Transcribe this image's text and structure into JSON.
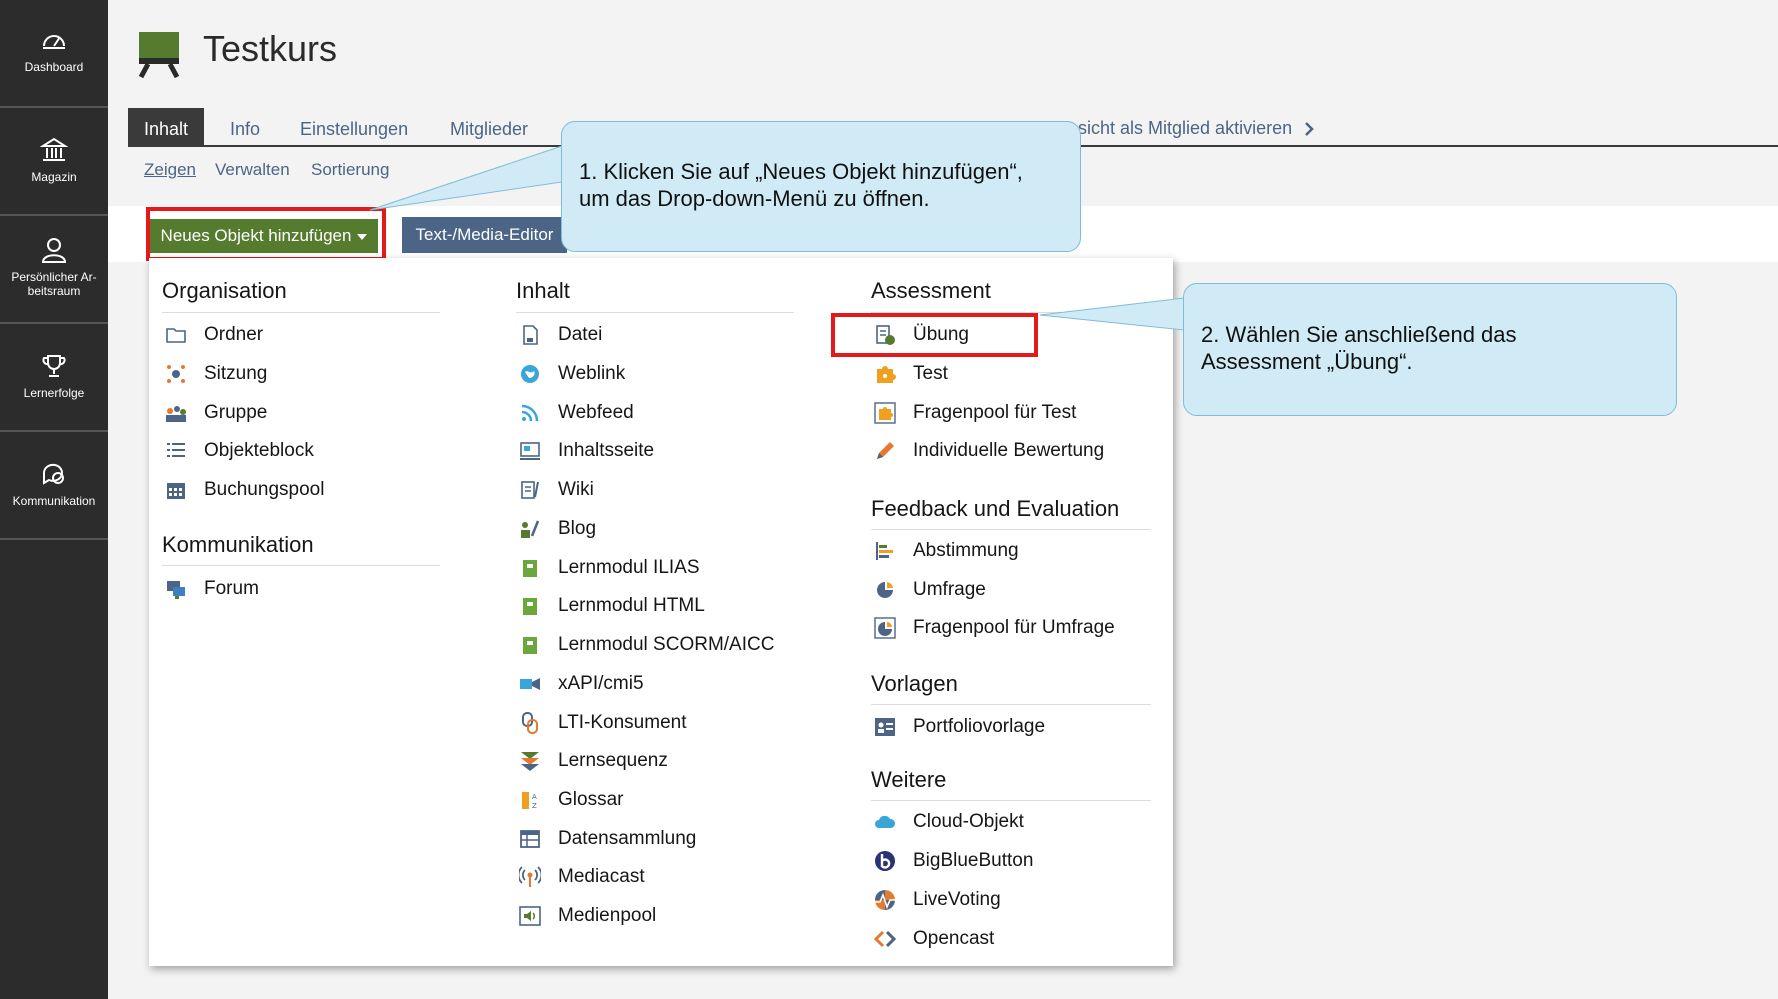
{
  "sidebar": {
    "items": [
      {
        "label": "Dashboard",
        "icon": "dashboard-icon"
      },
      {
        "label": "Magazin",
        "icon": "bank-icon"
      },
      {
        "label": "Persönlicher Ar-beitsraum",
        "icon": "user-icon"
      },
      {
        "label": "Lernerfolge",
        "icon": "trophy-icon"
      },
      {
        "label": "Kommunikation",
        "icon": "chat-icon"
      }
    ]
  },
  "header": {
    "title": "Testkurs",
    "icon": "course-board-icon",
    "accent_color": "#557b2e"
  },
  "tabs": [
    {
      "label": "Inhalt",
      "active": true
    },
    {
      "label": "Info"
    },
    {
      "label": "Einstellungen"
    },
    {
      "label": "Mitglieder"
    }
  ],
  "member_link": {
    "label": "nsicht als Mitglied aktivieren"
  },
  "subtabs": [
    {
      "label": "Zeigen",
      "active": true
    },
    {
      "label": "Verwalten"
    },
    {
      "label": "Sortierung"
    }
  ],
  "toolbar": {
    "add_label": "Neues Objekt hinzufügen",
    "editor_label": "Text-/Media-Editor"
  },
  "menu": {
    "organisation": {
      "title": "Organisation",
      "items": [
        "Ordner",
        "Sitzung",
        "Gruppe",
        "Objekteblock",
        "Buchungspool"
      ]
    },
    "kommunikation": {
      "title": "Kommunikation",
      "items": [
        "Forum"
      ]
    },
    "inhalt": {
      "title": "Inhalt",
      "items": [
        "Datei",
        "Weblink",
        "Webfeed",
        "Inhaltsseite",
        "Wiki",
        "Blog",
        "Lernmodul ILIAS",
        "Lernmodul HTML",
        "Lernmodul SCORM/AICC",
        "xAPI/cmi5",
        "LTI-Konsument",
        "Lernsequenz",
        "Glossar",
        "Datensammlung",
        "Mediacast",
        "Medienpool"
      ]
    },
    "assessment": {
      "title": "Assessment",
      "items": [
        "Übung",
        "Test",
        "Fragenpool für Test",
        "Individuelle Bewertung"
      ]
    },
    "feedback": {
      "title": "Feedback und Evaluation",
      "items": [
        "Abstimmung",
        "Umfrage",
        "Fragenpool für Umfrage"
      ]
    },
    "vorlagen": {
      "title": "Vorlagen",
      "items": [
        "Portfoliovorlage"
      ]
    },
    "weitere": {
      "title": "Weitere",
      "items": [
        "Cloud-Objekt",
        "BigBlueButton",
        "LiveVoting",
        "Opencast"
      ]
    }
  },
  "callouts": {
    "step1": {
      "line1": "1. Klicken Sie auf „Neues Objekt hinzufügen“,",
      "line2": "um das Drop-down-Menü zu öffnen."
    },
    "step2": {
      "line1": "2. Wählen Sie anschließend das",
      "line2": "Assessment „Übung“."
    }
  },
  "colors": {
    "highlight": "#e3191a",
    "callout_bg": "#d0ebf6",
    "sidebar_bg": "#2c2c2c",
    "link": "#4c6586"
  }
}
